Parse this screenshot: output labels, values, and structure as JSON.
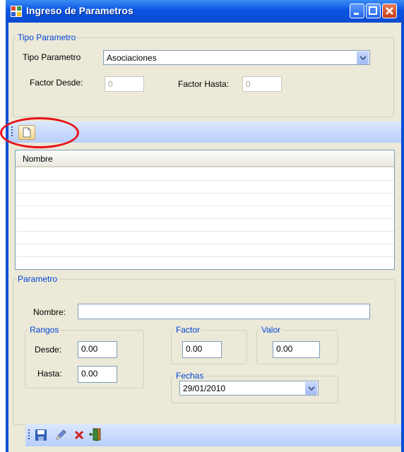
{
  "window": {
    "title": "Ingreso de Parametros"
  },
  "tipo_parametro_group": {
    "legend": "Tipo Parametro",
    "tipo_label": "Tipo Parametro",
    "tipo_value": "Asociaciones",
    "factor_desde_label": "Factor Desde:",
    "factor_desde_value": "0",
    "factor_hasta_label": "Factor Hasta:",
    "factor_hasta_value": "0"
  },
  "toolbar_top": {
    "items": [
      {
        "icon": "new-document-icon"
      }
    ]
  },
  "grid": {
    "columns": [
      "Nombre"
    ],
    "rows": []
  },
  "parametro_group": {
    "legend": "Parametro",
    "nombre_label": "Nombre:",
    "nombre_value": "",
    "rangos": {
      "legend": "Rangos",
      "desde_label": "Desde:",
      "desde_value": "0.00",
      "hasta_label": "Hasta:",
      "hasta_value": "0.00"
    },
    "factor": {
      "legend": "Factor",
      "value": "0.00"
    },
    "valor": {
      "legend": "Valor",
      "value": "0.00"
    },
    "fechas": {
      "legend": "Fechas",
      "value": "29/01/2010"
    }
  },
  "toolbar_bottom": {
    "items": [
      {
        "icon": "save-icon"
      },
      {
        "icon": "edit-pencil-icon"
      },
      {
        "icon": "delete-x-icon"
      },
      {
        "icon": "exit-door-icon"
      }
    ]
  },
  "colors": {
    "legend_text": "#0046d5",
    "toolstrip": "#b7cefb",
    "annotation_circle": "#e8141a"
  }
}
